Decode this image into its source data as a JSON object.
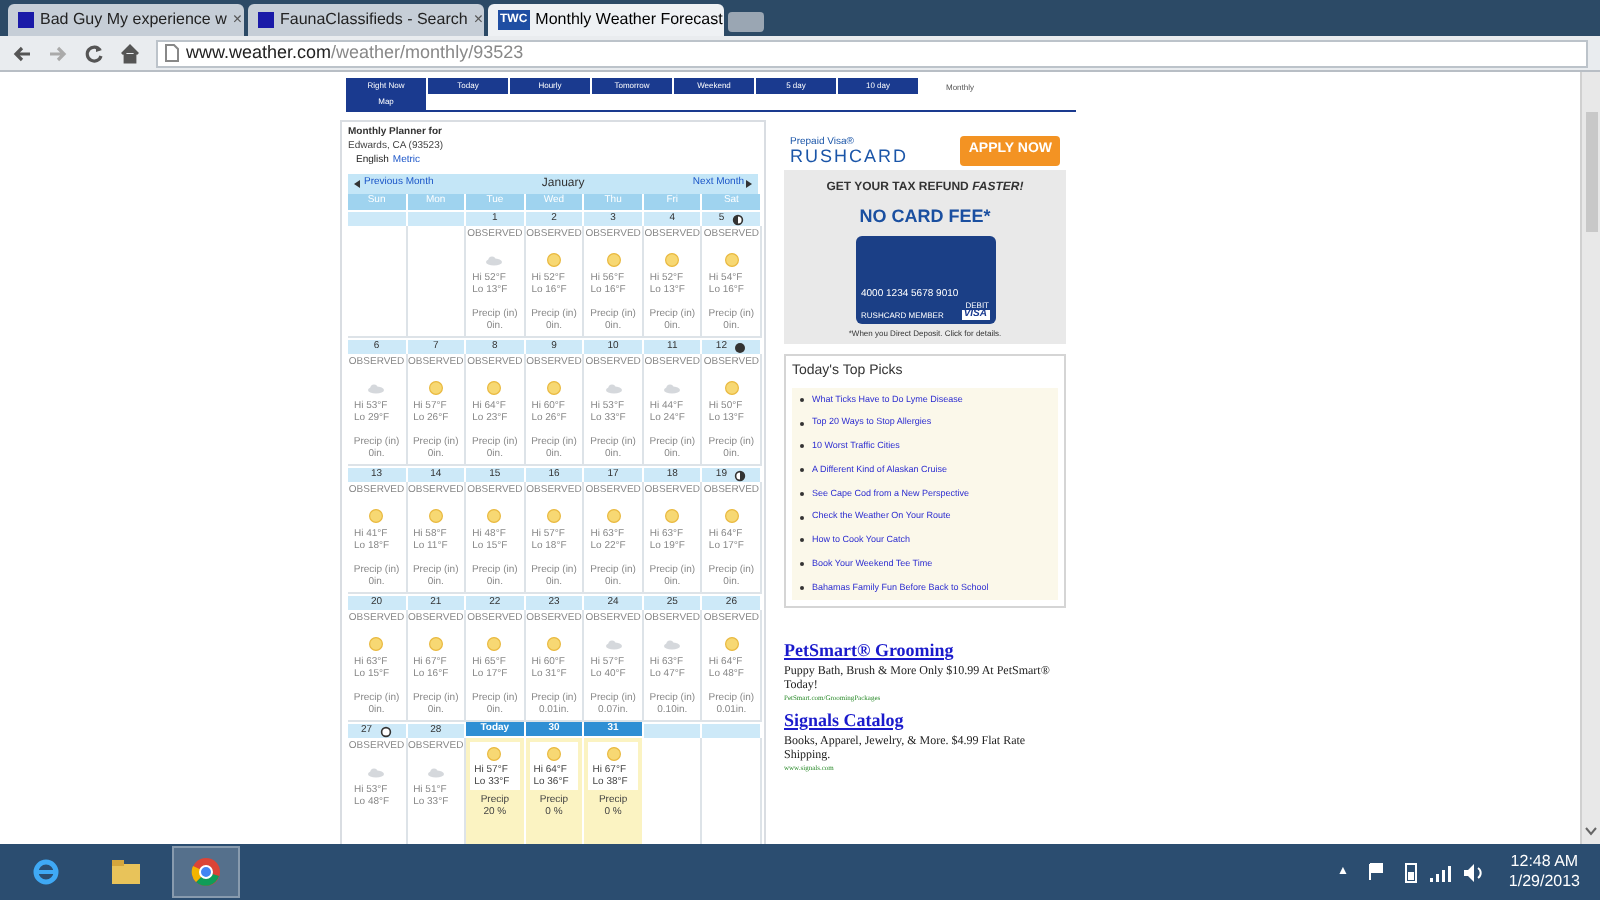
{
  "browser": {
    "tabs": [
      {
        "title": "Bad Guy My experience w",
        "favicon": {
          "kind": "square"
        },
        "selected": false
      },
      {
        "title": "FaunaClassifieds - Search",
        "favicon": {
          "kind": "square"
        },
        "selected": false
      },
      {
        "title": "Monthly Weather Forecast",
        "favicon": {
          "kind": "badge",
          "text": "TWC"
        },
        "selected": true
      }
    ],
    "close_glyph": "×",
    "address": {
      "domain": "www.weather.com",
      "path": "/weather/monthly/93523"
    }
  },
  "nav_tabs": [
    {
      "label": "Right Now",
      "selected": false
    },
    {
      "label": "Today",
      "selected": false
    },
    {
      "label": "Hourly",
      "selected": false
    },
    {
      "label": "Tomorrow",
      "selected": false
    },
    {
      "label": "Weekend",
      "selected": false
    },
    {
      "label": "5 day",
      "selected": false
    },
    {
      "label": "10 day",
      "selected": false
    },
    {
      "label": "Monthly",
      "selected": true
    },
    {
      "label": "Map",
      "selected": false
    }
  ],
  "planner": {
    "title": "Monthly Planner for",
    "location": "Edwards, CA (93523)",
    "units": [
      {
        "label": "English",
        "selected": true
      },
      {
        "label": "Metric",
        "selected": false
      }
    ],
    "calendar": {
      "previous": "Previous Month",
      "month": "January",
      "next": "Next Month",
      "weekdays": [
        "Sun",
        "Mon",
        "Tue",
        "Wed",
        "Thu",
        "Fri",
        "Sat"
      ],
      "weeks": [
        {
          "days": [
            {
              "kind": "empty"
            },
            {
              "kind": "empty"
            },
            {
              "kind": "observed",
              "date": "1",
              "status": "OBSERVED",
              "icon": {
                "kind": "cloudy"
              },
              "hi": "Hi 52°F",
              "lo": "Lo 13°F",
              "precip_label": "Precip (in)",
              "precip": "0in."
            },
            {
              "kind": "observed",
              "date": "2",
              "status": "OBSERVED",
              "icon": {
                "kind": "sunny"
              },
              "hi": "Hi 52°F",
              "lo": "Lo 16°F",
              "precip_label": "Precip (in)",
              "precip": "0in."
            },
            {
              "kind": "observed",
              "date": "3",
              "status": "OBSERVED",
              "icon": {
                "kind": "sunny"
              },
              "hi": "Hi 56°F",
              "lo": "Lo 16°F",
              "precip_label": "Precip (in)",
              "precip": "0in."
            },
            {
              "kind": "observed",
              "date": "4",
              "status": "OBSERVED",
              "icon": {
                "kind": "sunny"
              },
              "hi": "Hi 52°F",
              "lo": "Lo 13°F",
              "precip_label": "Precip (in)",
              "precip": "0in."
            },
            {
              "kind": "observed",
              "date": "5",
              "moon": {
                "kind": "last_quarter"
              },
              "status": "OBSERVED",
              "icon": {
                "kind": "sunny"
              },
              "hi": "Hi 54°F",
              "lo": "Lo 16°F",
              "precip_label": "Precip (in)",
              "precip": "0in."
            }
          ]
        },
        {
          "days": [
            {
              "kind": "observed",
              "date": "6",
              "status": "OBSERVED",
              "icon": {
                "kind": "cloudy"
              },
              "hi": "Hi 53°F",
              "lo": "Lo 29°F",
              "precip_label": "Precip (in)",
              "precip": "0in."
            },
            {
              "kind": "observed",
              "date": "7",
              "status": "OBSERVED",
              "icon": {
                "kind": "sunny"
              },
              "hi": "Hi 57°F",
              "lo": "Lo 26°F",
              "precip_label": "Precip (in)",
              "precip": "0in."
            },
            {
              "kind": "observed",
              "date": "8",
              "status": "OBSERVED",
              "icon": {
                "kind": "sunny"
              },
              "hi": "Hi 64°F",
              "lo": "Lo 23°F",
              "precip_label": "Precip (in)",
              "precip": "0in."
            },
            {
              "kind": "observed",
              "date": "9",
              "status": "OBSERVED",
              "icon": {
                "kind": "sunny"
              },
              "hi": "Hi 60°F",
              "lo": "Lo 26°F",
              "precip_label": "Precip (in)",
              "precip": "0in."
            },
            {
              "kind": "observed",
              "date": "10",
              "status": "OBSERVED",
              "icon": {
                "kind": "cloudy"
              },
              "hi": "Hi 53°F",
              "lo": "Lo 33°F",
              "precip_label": "Precip (in)",
              "precip": "0in."
            },
            {
              "kind": "observed",
              "date": "11",
              "status": "OBSERVED",
              "icon": {
                "kind": "cloudy"
              },
              "hi": "Hi 44°F",
              "lo": "Lo 24°F",
              "precip_label": "Precip (in)",
              "precip": "0in."
            },
            {
              "kind": "observed",
              "date": "12",
              "moon": {
                "kind": "new"
              },
              "status": "OBSERVED",
              "icon": {
                "kind": "sunny"
              },
              "hi": "Hi 50°F",
              "lo": "Lo 13°F",
              "precip_label": "Precip (in)",
              "precip": "0in."
            }
          ]
        },
        {
          "days": [
            {
              "kind": "observed",
              "date": "13",
              "status": "OBSERVED",
              "icon": {
                "kind": "sunny"
              },
              "hi": "Hi 41°F",
              "lo": "Lo 18°F",
              "precip_label": "Precip (in)",
              "precip": "0in."
            },
            {
              "kind": "observed",
              "date": "14",
              "status": "OBSERVED",
              "icon": {
                "kind": "sunny"
              },
              "hi": "Hi 58°F",
              "lo": "Lo 11°F",
              "precip_label": "Precip (in)",
              "precip": "0in."
            },
            {
              "kind": "observed",
              "date": "15",
              "status": "OBSERVED",
              "icon": {
                "kind": "sunny"
              },
              "hi": "Hi 48°F",
              "lo": "Lo 15°F",
              "precip_label": "Precip (in)",
              "precip": "0in."
            },
            {
              "kind": "observed",
              "date": "16",
              "status": "OBSERVED",
              "icon": {
                "kind": "sunny"
              },
              "hi": "Hi 57°F",
              "lo": "Lo 18°F",
              "precip_label": "Precip (in)",
              "precip": "0in."
            },
            {
              "kind": "observed",
              "date": "17",
              "status": "OBSERVED",
              "icon": {
                "kind": "sunny"
              },
              "hi": "Hi 63°F",
              "lo": "Lo 22°F",
              "precip_label": "Precip (in)",
              "precip": "0in."
            },
            {
              "kind": "observed",
              "date": "18",
              "status": "OBSERVED",
              "icon": {
                "kind": "sunny"
              },
              "hi": "Hi 63°F",
              "lo": "Lo 19°F",
              "precip_label": "Precip (in)",
              "precip": "0in."
            },
            {
              "kind": "observed",
              "date": "19",
              "moon": {
                "kind": "first_quarter"
              },
              "status": "OBSERVED",
              "icon": {
                "kind": "sunny"
              },
              "hi": "Hi 64°F",
              "lo": "Lo 17°F",
              "precip_label": "Precip (in)",
              "precip": "0in."
            }
          ]
        },
        {
          "days": [
            {
              "kind": "observed",
              "date": "20",
              "status": "OBSERVED",
              "icon": {
                "kind": "sunny"
              },
              "hi": "Hi 63°F",
              "lo": "Lo 15°F",
              "precip_label": "Precip (in)",
              "precip": "0in."
            },
            {
              "kind": "observed",
              "date": "21",
              "status": "OBSERVED",
              "icon": {
                "kind": "sunny"
              },
              "hi": "Hi 67°F",
              "lo": "Lo 16°F",
              "precip_label": "Precip (in)",
              "precip": "0in."
            },
            {
              "kind": "observed",
              "date": "22",
              "status": "OBSERVED",
              "icon": {
                "kind": "sunny"
              },
              "hi": "Hi 65°F",
              "lo": "Lo 17°F",
              "precip_label": "Precip (in)",
              "precip": "0in."
            },
            {
              "kind": "observed",
              "date": "23",
              "status": "OBSERVED",
              "icon": {
                "kind": "sunny"
              },
              "hi": "Hi 60°F",
              "lo": "Lo 31°F",
              "precip_label": "Precip (in)",
              "precip": "0.01in."
            },
            {
              "kind": "observed",
              "date": "24",
              "status": "OBSERVED",
              "icon": {
                "kind": "cloudy"
              },
              "hi": "Hi 57°F",
              "lo": "Lo 40°F",
              "precip_label": "Precip (in)",
              "precip": "0.07in."
            },
            {
              "kind": "observed",
              "date": "25",
              "status": "OBSERVED",
              "icon": {
                "kind": "cloudy"
              },
              "hi": "Hi 63°F",
              "lo": "Lo 47°F",
              "precip_label": "Precip (in)",
              "precip": "0.10in."
            },
            {
              "kind": "observed",
              "date": "26",
              "status": "OBSERVED",
              "icon": {
                "kind": "sunny"
              },
              "hi": "Hi 64°F",
              "lo": "Lo 48°F",
              "precip_label": "Precip (in)",
              "precip": "0.01in."
            }
          ]
        },
        {
          "days": [
            {
              "kind": "observed",
              "date": "27",
              "moon": {
                "kind": "full"
              },
              "status": "OBSERVED",
              "icon": {
                "kind": "cloudy"
              },
              "hi": "Hi 53°F",
              "lo": "Lo 48°F"
            },
            {
              "kind": "observed",
              "date": "28",
              "status": "OBSERVED",
              "icon": {
                "kind": "cloudy"
              },
              "hi": "Hi 51°F",
              "lo": "Lo 33°F"
            },
            {
              "kind": "forecast",
              "date": "Today",
              "icon": {
                "kind": "sunny"
              },
              "hi": "Hi 57°F",
              "lo": "Lo 33°F",
              "precip_label": "Precip",
              "precip": "20 %"
            },
            {
              "kind": "forecast",
              "date": "30",
              "icon": {
                "kind": "sunny"
              },
              "hi": "Hi 64°F",
              "lo": "Lo 36°F",
              "precip_label": "Precip",
              "precip": "0 %"
            },
            {
              "kind": "forecast",
              "date": "31",
              "icon": {
                "kind": "sunny"
              },
              "hi": "Hi 67°F",
              "lo": "Lo 38°F",
              "precip_label": "Precip",
              "precip": "0 %"
            },
            {
              "kind": "empty"
            },
            {
              "kind": "empty"
            }
          ]
        }
      ]
    }
  },
  "ad": {
    "brand_top": "Prepaid Visa®",
    "brand": "RUSHCARD",
    "apply": "APPLY NOW",
    "headline": "GET YOUR **TAX REFUND** *FASTER!*",
    "offer": "NO CARD FEE*",
    "card_number": "4000 1234 5678 9010",
    "card_name": "RUSHCARD MEMBER",
    "card_type": "DEBIT",
    "card_network": "VISA",
    "footnote": "*When you Direct Deposit. Click for details."
  },
  "top_picks": {
    "title": "Today's Top Picks",
    "items": [
      "What Ticks Have to Do Lyme Disease",
      "Top 20 Ways to Stop Allergies",
      "10 Worst Traffic Cities",
      "A Different Kind of Alaskan Cruise",
      "See Cape Cod from a New Perspective",
      "Check the Weather On Your Route",
      "How to Cook Your Catch",
      "Book Your Weekend Tee Time",
      "Bahamas Family Fun Before Back to School"
    ]
  },
  "text_ads": [
    {
      "title": "PetSmart® Grooming",
      "body": "Puppy Bath, Brush & More Only $10.99 At PetSmart® Today!",
      "url": "PetSmart.com/GroomingPackages"
    },
    {
      "title": "Signals Catalog",
      "body": "Books, Apparel, Jewelry, & More. $4.99 Flat Rate Shipping.",
      "url": "www.signals.com"
    }
  ],
  "taskbar": {
    "apps": [
      {
        "kind": "ie",
        "selected": false
      },
      {
        "kind": "folder",
        "selected": false
      },
      {
        "kind": "chrome",
        "selected": true
      }
    ],
    "tray_arrow": "▲",
    "time": "12:48 AM",
    "date": "1/29/2013"
  }
}
